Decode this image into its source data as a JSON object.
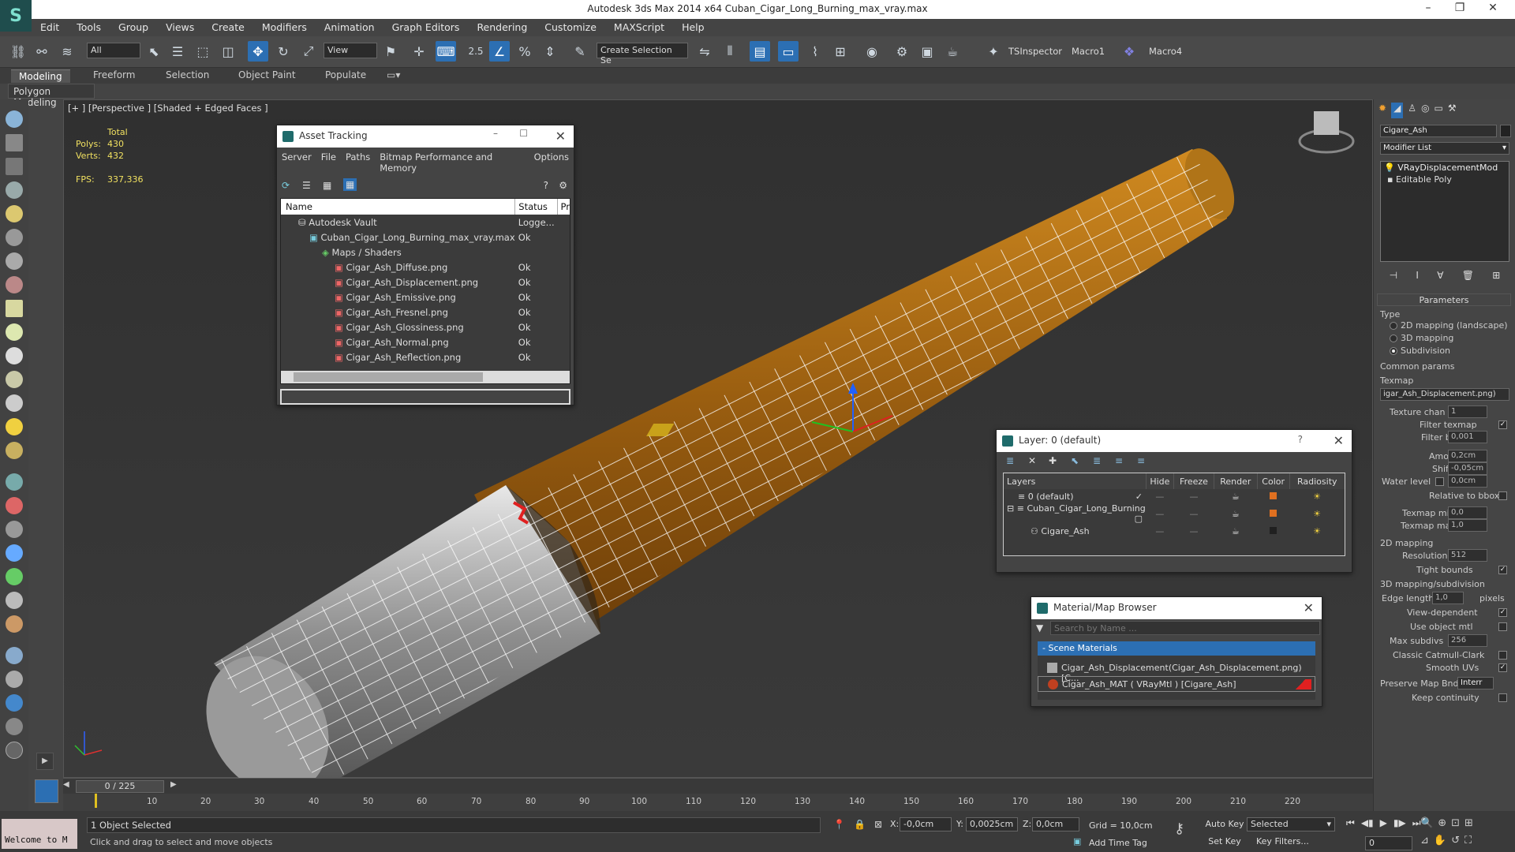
{
  "window": {
    "title": "Autodesk 3ds Max  2014 x64     Cuban_Cigar_Long_Burning_max_vray.max"
  },
  "menu": [
    "Edit",
    "Tools",
    "Group",
    "Views",
    "Create",
    "Modifiers",
    "Animation",
    "Graph Editors",
    "Rendering",
    "Customize",
    "MAXScript",
    "Help"
  ],
  "toolbar": {
    "selection_filter": "All",
    "ref_coord": "View",
    "snap_value": "2.5",
    "named_selection": "Create Selection Se",
    "ts_inspector": "TSInspector",
    "macro1": "Macro1",
    "macro4": "Macro4"
  },
  "ribbon": {
    "tabs": [
      "Modeling",
      "Freeform",
      "Selection",
      "Object Paint",
      "Populate"
    ],
    "active_panel": "Polygon Modeling"
  },
  "viewport": {
    "label": "[+ ] [Perspective ] [Shaded + Edged Faces ]",
    "stats": {
      "total_label": "Total",
      "polys_label": "Polys:",
      "polys": "430",
      "verts_label": "Verts:",
      "verts": "432",
      "fps_label": "FPS:",
      "fps": "337,336"
    }
  },
  "asset_tracking": {
    "title": "Asset Tracking",
    "menu": [
      "Server",
      "File",
      "Paths",
      "Bitmap Performance and Memory",
      "Options"
    ],
    "columns": [
      "Name",
      "Status",
      "Pr"
    ],
    "rows": [
      {
        "name": "Autodesk Vault",
        "status": "Logge..."
      },
      {
        "name": "Cuban_Cigar_Long_Burning_max_vray.max",
        "status": "Ok"
      },
      {
        "name": "Maps / Shaders",
        "status": ""
      },
      {
        "name": "Cigar_Ash_Diffuse.png",
        "status": "Ok"
      },
      {
        "name": "Cigar_Ash_Displacement.png",
        "status": "Ok"
      },
      {
        "name": "Cigar_Ash_Emissive.png",
        "status": "Ok"
      },
      {
        "name": "Cigar_Ash_Fresnel.png",
        "status": "Ok"
      },
      {
        "name": "Cigar_Ash_Glossiness.png",
        "status": "Ok"
      },
      {
        "name": "Cigar_Ash_Normal.png",
        "status": "Ok"
      },
      {
        "name": "Cigar_Ash_Reflection.png",
        "status": "Ok"
      }
    ]
  },
  "layer_dialog": {
    "title": "Layer: 0 (default)",
    "columns": [
      "Layers",
      "Hide",
      "Freeze",
      "Render",
      "Color",
      "Radiosity"
    ],
    "rows": [
      {
        "name": "0 (default)",
        "color": "#e07020"
      },
      {
        "name": "Cuban_Cigar_Long_Burning",
        "color": "#e07020"
      },
      {
        "name": "Cigare_Ash",
        "color": "#202020"
      }
    ]
  },
  "material_browser": {
    "title": "Material/Map Browser",
    "search_placeholder": "Search by Name ...",
    "group": "- Scene Materials",
    "items": [
      "Cigar_Ash_Displacement(Cigar_Ash_Displacement.png) [C...",
      "Cigar_Ash_MAT  ( VRayMtl )  [Cigare_Ash]"
    ]
  },
  "command_panel": {
    "object_name": "Cigare_Ash",
    "modifier_list": "Modifier List",
    "stack": [
      "VRayDisplacementMod",
      "Editable Poly"
    ],
    "parameters": "Parameters",
    "type_label": "Type",
    "types": [
      "2D mapping (landscape)",
      "3D mapping",
      "Subdivision"
    ],
    "common_params": "Common params",
    "texmap_label": "Texmap",
    "texmap": "igar_Ash_Displacement.png)",
    "texture_chan_label": "Texture chan",
    "texture_chan": "1",
    "filter_texmap_label": "Filter texmap",
    "filter_blur_label": "Filter blur",
    "filter_blur": "0,001",
    "amount_label": "Amount",
    "amount": "0,2cm",
    "shift_label": "Shift",
    "shift": "-0,05cm",
    "water_level_label": "Water level",
    "water_level": "0,0cm",
    "relative_bbox_label": "Relative to bbox",
    "texmap_min_label": "Texmap min",
    "texmap_min": "0,0",
    "texmap_max_label": "Texmap max",
    "texmap_max": "1,0",
    "mapping2d": "2D mapping",
    "resolution_label": "Resolution",
    "resolution": "512",
    "tight_bounds_label": "Tight bounds",
    "mapping3d": "3D mapping/subdivision",
    "edge_length_label": "Edge length",
    "edge_length": "1,0",
    "pixels_label": "pixels",
    "view_dependent_label": "View-dependent",
    "use_object_mtl_label": "Use object mtl",
    "max_subdivs_label": "Max subdivs",
    "max_subdivs": "256",
    "classic_cc_label": "Classic Catmull-Clark",
    "smooth_uvs_label": "Smooth UVs",
    "preserve_map_label": "Preserve Map Bnd",
    "preserve_map": "Interr",
    "keep_continuity_label": "Keep continuity"
  },
  "timeline": {
    "frame": "0 / 225",
    "ticks": [
      "10",
      "20",
      "30",
      "40",
      "50",
      "60",
      "70",
      "80",
      "90",
      "100",
      "110",
      "120",
      "130",
      "140",
      "150",
      "160",
      "170",
      "180",
      "190",
      "200",
      "210",
      "220"
    ]
  },
  "status": {
    "welcome": "Welcome to M",
    "selected": "1 Object Selected",
    "hint": "Click and drag to select and move objects",
    "x": "-0,0cm",
    "y": "0,0025cm",
    "z": "0,0cm",
    "grid": "Grid = 10,0cm",
    "add_time_tag": "Add Time Tag",
    "auto_key": "Auto Key",
    "auto_key_mode": "Selected",
    "set_key": "Set Key",
    "key_filters": "Key Filters...",
    "frame": "0"
  }
}
